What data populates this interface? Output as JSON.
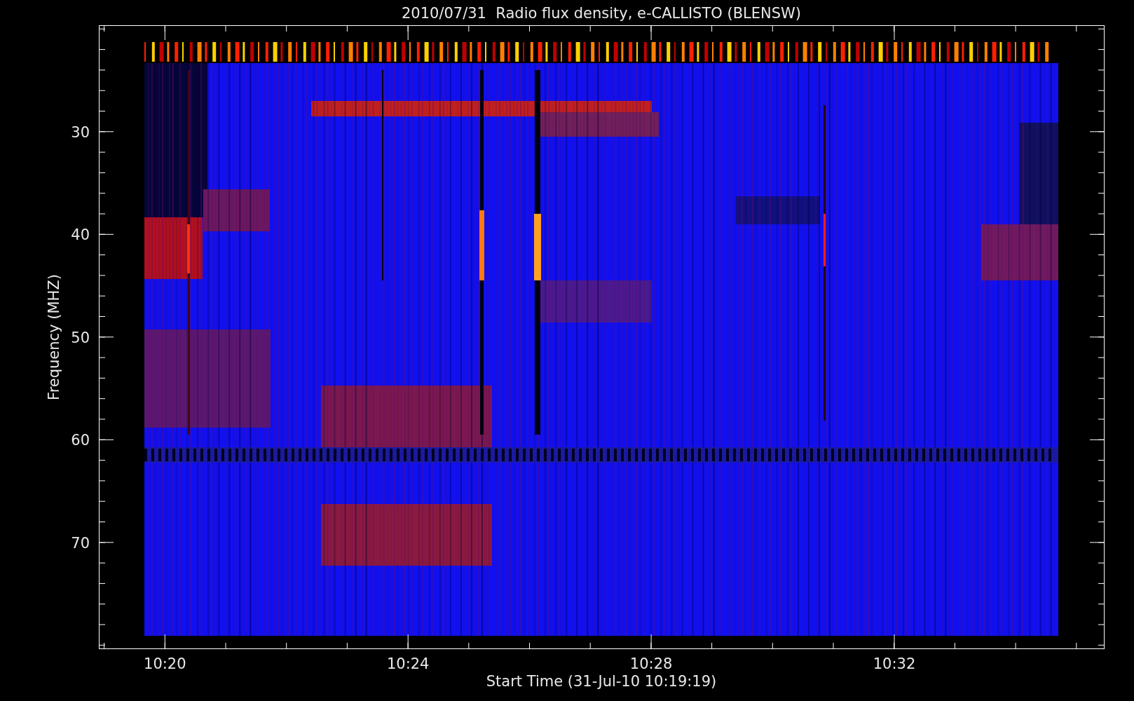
{
  "title": "2010/07/31  Radio flux density, e-CALLISTO (BLENSW)",
  "ylabel": "Frequency (MHZ)",
  "xlabel": "Start Time (31-Jul-10 10:19:19)",
  "xticks": [
    "10:20",
    "10:24",
    "10:28",
    "10:32"
  ],
  "yticks": [
    "30",
    "40",
    "50",
    "60",
    "70"
  ]
}
